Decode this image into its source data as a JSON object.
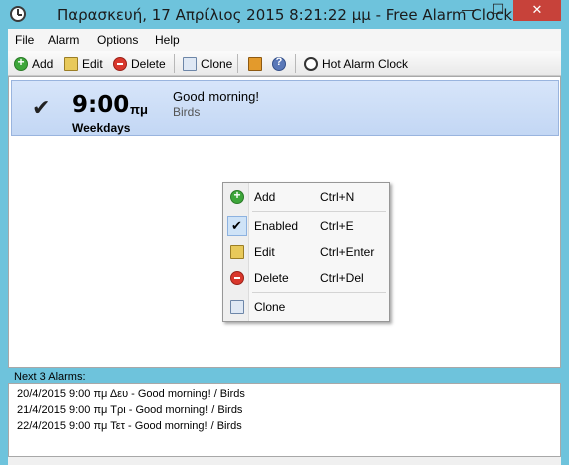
{
  "window": {
    "title": "Παρασκευή, 17 Απρίλιος 2015 8:21:22 μμ - Free Alarm Clock",
    "minimize": "—",
    "maximize": "☐",
    "close": "✕"
  },
  "menu": {
    "items": [
      "File",
      "Alarm",
      "Options",
      "Help"
    ]
  },
  "toolbar": {
    "add": "Add",
    "edit": "Edit",
    "delete": "Delete",
    "clone": "Clone",
    "hot_alarm": "Hot Alarm Clock"
  },
  "alarms": [
    {
      "enabled": true,
      "time": "9:00",
      "ampm": "πμ",
      "days": "Weekdays",
      "label": "Good morning!",
      "sound": "Birds"
    }
  ],
  "context_menu": {
    "items": [
      {
        "label": "Add",
        "shortcut": "Ctrl+N"
      },
      {
        "label": "Enabled",
        "shortcut": "Ctrl+E"
      },
      {
        "label": "Edit",
        "shortcut": "Ctrl+Enter"
      },
      {
        "label": "Delete",
        "shortcut": "Ctrl+Del"
      },
      {
        "label": "Clone",
        "shortcut": ""
      }
    ]
  },
  "next": {
    "label": "Next 3 Alarms:",
    "rows": [
      "20/4/2015 9:00 πμ Δευ - Good morning! / Birds",
      "21/4/2015 9:00 πμ Τρι - Good morning! / Birds",
      "22/4/2015 9:00 πμ Τετ - Good morning! / Birds"
    ]
  },
  "colors": {
    "titlebar": "#6ec3dc",
    "selection": "#c3d7f4",
    "close_button": "#c7423a"
  }
}
